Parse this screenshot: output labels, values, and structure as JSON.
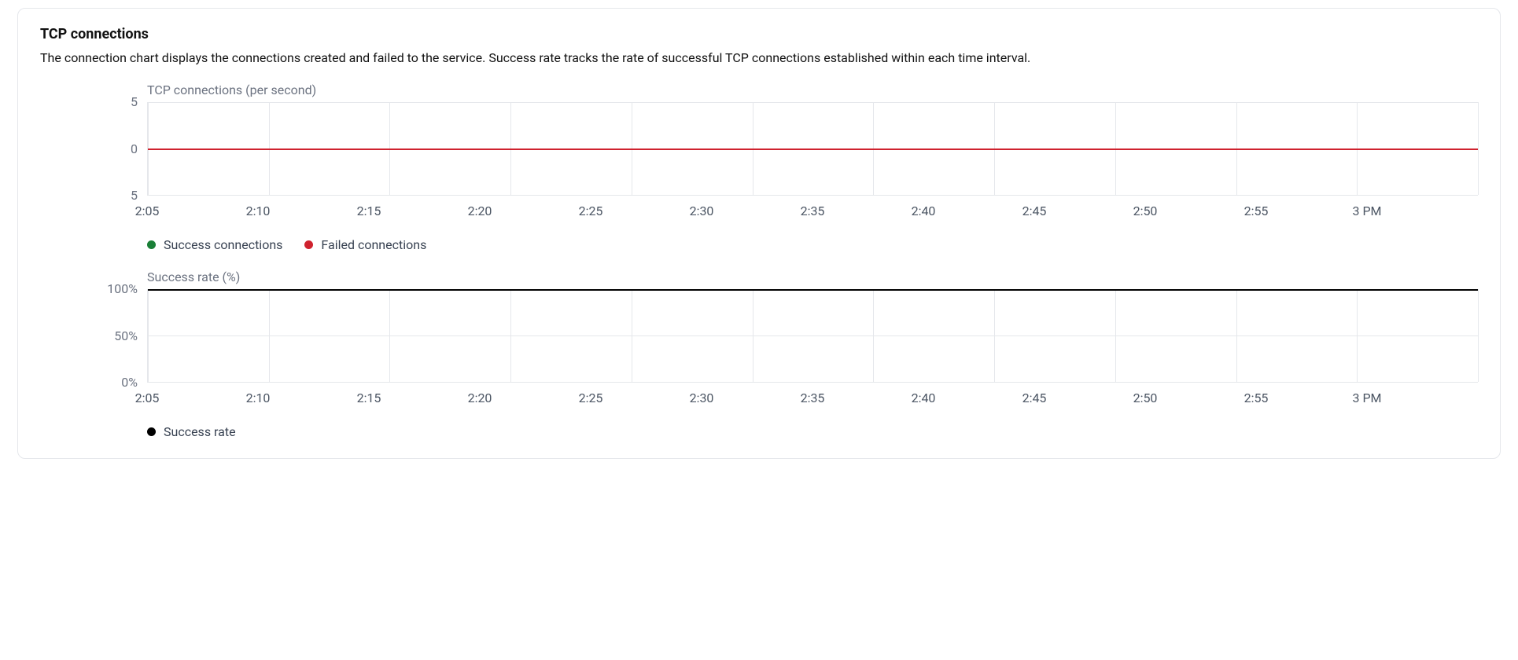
{
  "card": {
    "title": "TCP connections",
    "description": "The connection chart displays the connections created and failed to the service. Success rate tracks the rate of successful TCP connections established within each time interval."
  },
  "chart_data": [
    {
      "type": "line",
      "title": "TCP connections (per second)",
      "x": [
        "2:05",
        "2:10",
        "2:15",
        "2:20",
        "2:25",
        "2:30",
        "2:35",
        "2:40",
        "2:45",
        "2:50",
        "2:55",
        "3 PM"
      ],
      "y_ticks": [
        "5",
        "0",
        "5"
      ],
      "ylim": [
        -5,
        5
      ],
      "series": [
        {
          "name": "Success connections",
          "color": "#1a7f37",
          "values": [
            0,
            0,
            0,
            0,
            0,
            0,
            0,
            0,
            0,
            0,
            0,
            0
          ]
        },
        {
          "name": "Failed connections",
          "color": "#cf222e",
          "values": [
            0,
            0,
            0,
            0,
            0,
            0,
            0,
            0,
            0,
            0,
            0,
            0
          ]
        }
      ]
    },
    {
      "type": "line",
      "title": "Success rate (%)",
      "x": [
        "2:05",
        "2:10",
        "2:15",
        "2:20",
        "2:25",
        "2:30",
        "2:35",
        "2:40",
        "2:45",
        "2:50",
        "2:55",
        "3 PM"
      ],
      "y_ticks": [
        "100%",
        "50%",
        "0%"
      ],
      "ylim": [
        0,
        100
      ],
      "series": [
        {
          "name": "Success rate",
          "color": "#000000",
          "values": [
            100,
            100,
            100,
            100,
            100,
            100,
            100,
            100,
            100,
            100,
            100,
            100
          ]
        }
      ]
    }
  ]
}
